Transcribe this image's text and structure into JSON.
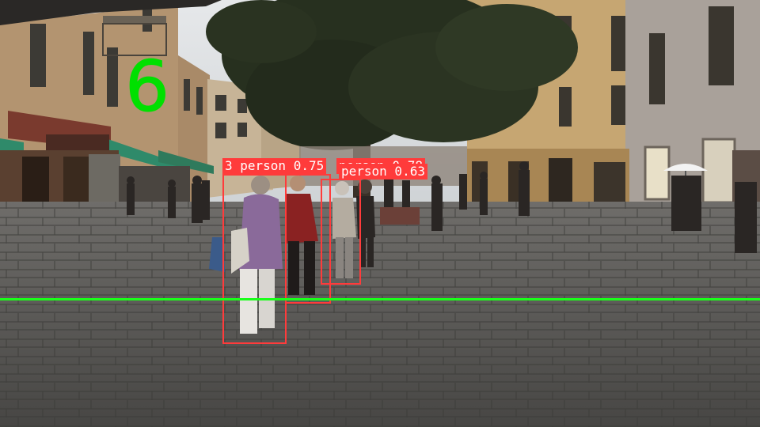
{
  "overlay": {
    "count": "6",
    "count_color": "#00e000",
    "line_color": "#1aff1a",
    "box_color": "#ff3b3b"
  },
  "detections": [
    {
      "label": "3 person 0.75"
    },
    {
      "label": "person 0.78"
    },
    {
      "label": "person 0.63"
    }
  ]
}
